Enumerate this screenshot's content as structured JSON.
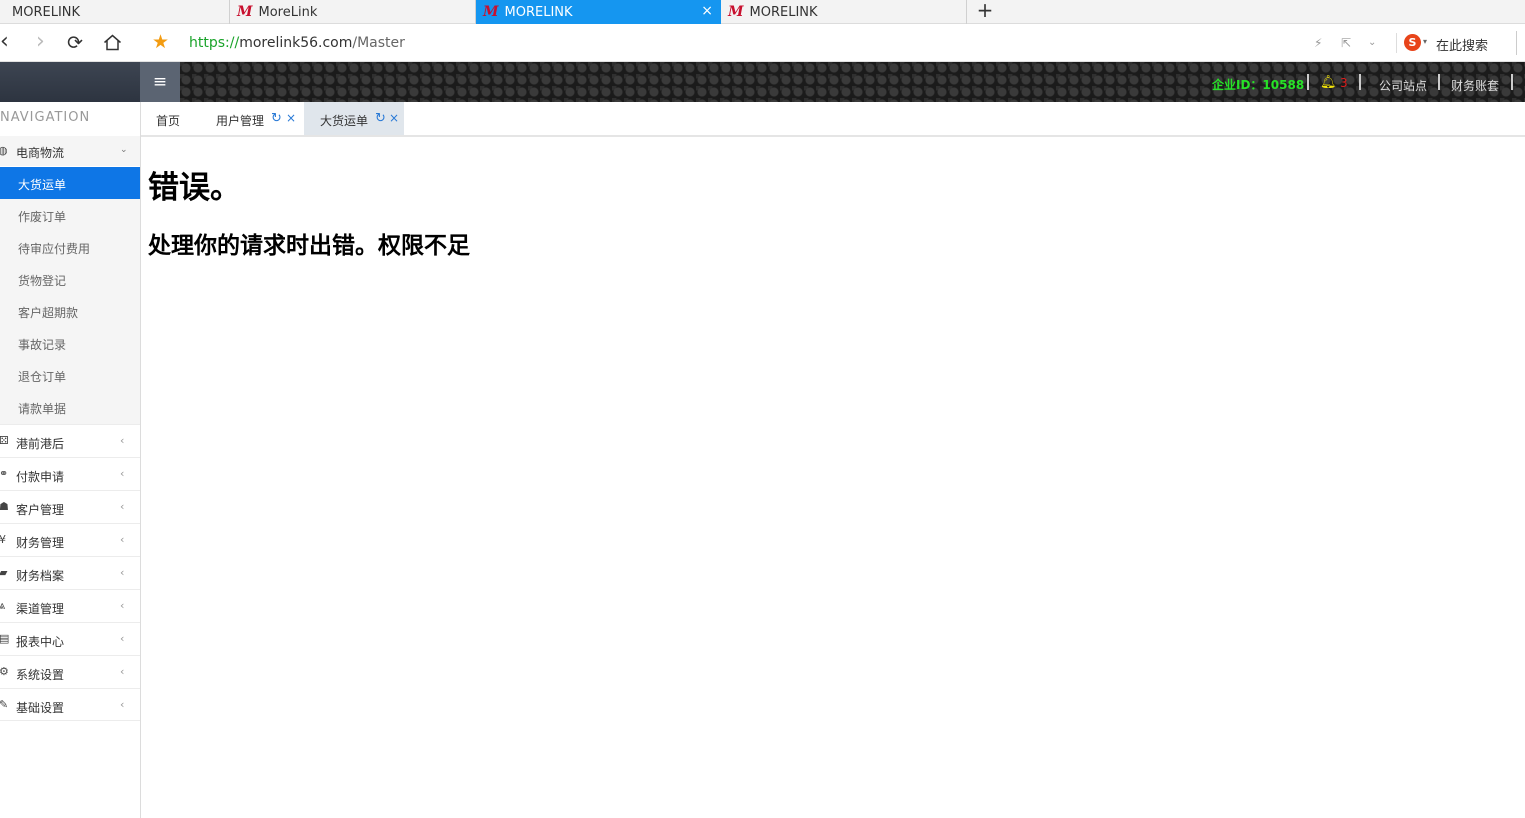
{
  "browser": {
    "tabs": [
      {
        "label": "MORELINK",
        "logo": "",
        "active": false
      },
      {
        "label": "MoreLink",
        "logo": "M",
        "active": false
      },
      {
        "label": "MORELINK",
        "logo": "M",
        "active": true
      },
      {
        "label": "MORELINK",
        "logo": "M",
        "active": false
      }
    ],
    "active_tab_close": "×",
    "new_tab": "+",
    "url_protocol": "https://",
    "url_host": "morelink56.com",
    "url_path": "/Master",
    "search_label": "在此搜索",
    "search_engine_glyph": "S"
  },
  "header": {
    "menu_glyph": "≡",
    "corp_id": "企业ID：10588",
    "notification_count": "3",
    "links": [
      "公司站点",
      "财务账套"
    ]
  },
  "sidebar": {
    "title": "NAVIGATION",
    "open_group": {
      "label": "电商物流",
      "icon": "globe-icon",
      "items": [
        {
          "label": "大货运单",
          "active": true
        },
        {
          "label": "作废订单",
          "active": false
        },
        {
          "label": "待审应付费用",
          "active": false
        },
        {
          "label": "货物登记",
          "active": false
        },
        {
          "label": "客户超期款",
          "active": false
        },
        {
          "label": "事故记录",
          "active": false
        },
        {
          "label": "退仓订单",
          "active": false
        },
        {
          "label": "请款单据",
          "active": false
        }
      ]
    },
    "menus": [
      {
        "label": "港前港后",
        "icon": "cubes-icon"
      },
      {
        "label": "付款申请",
        "icon": "handshake-icon"
      },
      {
        "label": "客户管理",
        "icon": "users-icon"
      },
      {
        "label": "财务管理",
        "icon": "yen-icon"
      },
      {
        "label": "财务档案",
        "icon": "book-icon"
      },
      {
        "label": "渠道管理",
        "icon": "road-icon"
      },
      {
        "label": "报表中心",
        "icon": "report-icon"
      },
      {
        "label": "系统设置",
        "icon": "gear-icon"
      },
      {
        "label": "基础设置",
        "icon": "edit-icon"
      }
    ]
  },
  "page_tabs": [
    {
      "label": "首页",
      "closable": false,
      "active": false
    },
    {
      "label": "用户管理",
      "closable": true,
      "active": false
    },
    {
      "label": "大货运单",
      "closable": true,
      "active": true
    }
  ],
  "content": {
    "error_title": "错误。",
    "error_message": "处理你的请求时出错。权限不足"
  }
}
